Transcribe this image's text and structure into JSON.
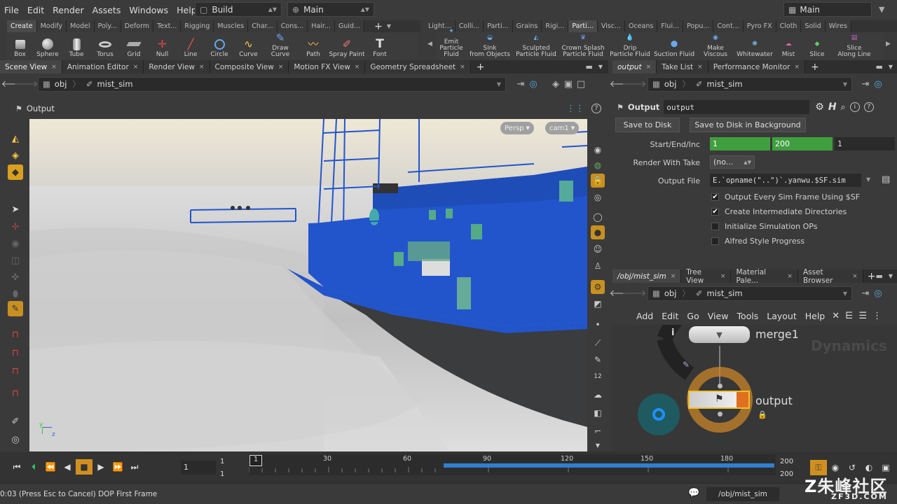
{
  "menubar": {
    "items": [
      "File",
      "Edit",
      "Render",
      "Assets",
      "Windows",
      "Help"
    ],
    "desktop": "Build",
    "context": "Main",
    "desktop_right": "Main"
  },
  "shelf_left": {
    "tabs": [
      "Create",
      "Modify",
      "Model",
      "Poly...",
      "Deform",
      "Text...",
      "Rigging",
      "Muscles",
      "Char...",
      "Cons...",
      "Hair...",
      "Guid..."
    ],
    "tools": [
      "Box",
      "Sphere",
      "Tube",
      "Torus",
      "Grid",
      "Null",
      "Line",
      "Circle",
      "Curve",
      "Draw Curve",
      "Path",
      "Spray Paint",
      "Font"
    ]
  },
  "shelf_right": {
    "tabs": [
      "Light...",
      "Colli...",
      "Parti...",
      "Grains",
      "Rigi...",
      "Parti...",
      "Visc...",
      "Oceans",
      "Flui...",
      "Popu...",
      "Cont...",
      "Pyro FX",
      "Cloth",
      "Solid",
      "Wires"
    ],
    "tools": [
      [
        "Emit",
        "Particle Fluid"
      ],
      [
        "Sink",
        "from Objects"
      ],
      [
        "Sculpted",
        "Particle Fluid"
      ],
      [
        "Crown Splash",
        "Particle Fluid"
      ],
      [
        "Drip",
        "Particle Fluid"
      ],
      [
        "",
        "Suction Fluid"
      ],
      [
        "",
        "Make Viscous"
      ],
      [
        "",
        "Whitewater"
      ],
      [
        "",
        "Mist"
      ],
      [
        "",
        "Slice"
      ],
      [
        "Slice",
        "Along Line"
      ]
    ]
  },
  "left_pane": {
    "tabs": [
      "Scene View",
      "Animation Editor",
      "Render View",
      "Composite View",
      "Motion FX View",
      "Geometry Spreadsheet"
    ],
    "path_root": "obj",
    "path_node": "mist_sim",
    "viewer_title": "Output",
    "persp": "Persp",
    "cam": "cam1",
    "axis_y": "y",
    "axis_z": "z"
  },
  "params": {
    "tabs": [
      "output",
      "Take List",
      "Performance Monitor"
    ],
    "path_root": "obj",
    "path_node": "mist_sim",
    "node_type": "Output",
    "node_name": "output",
    "save_disk": "Save to Disk",
    "save_bg": "Save to Disk in Background",
    "start_end_label": "Start/End/Inc",
    "start": "1",
    "end": "200",
    "inc": "1",
    "take_label": "Render With Take",
    "take_value": "(no...",
    "output_label": "Output File",
    "output_value": "E.`opname(\"..\")`.yanwu.$SF.sim",
    "checks": [
      {
        "label": "Output Every Sim Frame Using $SF",
        "checked": true
      },
      {
        "label": "Create Intermediate Directories",
        "checked": true
      },
      {
        "label": "Initialize Simulation OPs",
        "checked": false
      },
      {
        "label": "Alfred Style Progress",
        "checked": false
      }
    ]
  },
  "network": {
    "tabs": [
      "/obj/mist_sim",
      "Tree View",
      "Material Pale...",
      "Asset Browser"
    ],
    "path_root": "obj",
    "path_node": "mist_sim",
    "menu": [
      "Add",
      "Edit",
      "Go",
      "View",
      "Tools",
      "Layout",
      "Help"
    ],
    "watermark": "Dynamics",
    "node1": "merge1",
    "node2": "output"
  },
  "timeline": {
    "frame": "1",
    "start1": "1",
    "start2": "1",
    "end1": "200",
    "end2": "200",
    "marker": "1",
    "ticks": [
      "30",
      "60",
      "90",
      "120",
      "150",
      "180"
    ]
  },
  "status": {
    "text": "0:03 (Press Esc to Cancel) DOP First Frame",
    "path": "/obj/mist_sim",
    "logo": "朱峰社区",
    "logo_sub": "ZF3D.COM"
  },
  "colors": {
    "accent": "#f0b030",
    "field_green": "#3f9f3f",
    "timeline_blue": "#2f7fd0",
    "boat": "#2255cc"
  }
}
